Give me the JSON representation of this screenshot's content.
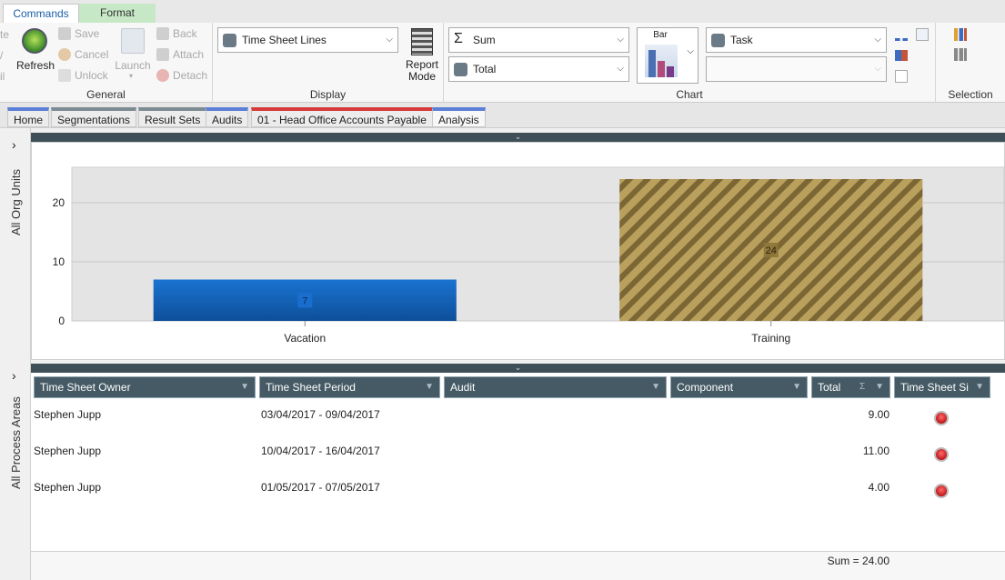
{
  "ribbon": {
    "tabs": [
      "Commands",
      "Format"
    ],
    "general": {
      "label": "General",
      "cut_left": [
        "te",
        "/",
        "il"
      ],
      "refresh": "Refresh",
      "save": "Save",
      "cancel": "Cancel",
      "unlock": "Unlock",
      "launch": "Launch",
      "back": "Back",
      "attach": "Attach",
      "detach": "Detach"
    },
    "display": {
      "label": "Display",
      "view_select": "Time Sheet Lines",
      "report_mode": [
        "Report",
        "Mode"
      ]
    },
    "chart": {
      "label": "Chart",
      "aggregate": "Sum",
      "value_field": "Total",
      "chart_type": "Bar",
      "category_field": "Task",
      "secondary_field": ""
    },
    "selection": {
      "label": "Selection"
    }
  },
  "doc_tabs": [
    {
      "label": "Home",
      "color": "#5b7fd6"
    },
    {
      "label": "Segmentations",
      "color": "#7c8a92"
    },
    {
      "label": "Result Sets",
      "color": "#7c8a92"
    },
    {
      "label": "Audits",
      "color": "#5b7fd6"
    },
    {
      "label": "01 - Head Office Accounts Payable",
      "color": "#d63a3a"
    },
    {
      "label": "Analysis",
      "color": "#5b7fd6"
    }
  ],
  "rail": {
    "top_label": "All Org Units",
    "bottom_label": "All Process Areas",
    "expand_glyph": "›"
  },
  "chart_data": {
    "type": "bar",
    "categories": [
      "Vacation",
      "Training"
    ],
    "values": [
      7,
      24
    ],
    "ylim": [
      0,
      26
    ],
    "yticks": [
      0,
      10,
      20
    ],
    "grid": true,
    "colors": [
      "#1565c0",
      "#a08a4c"
    ],
    "xlabel": "",
    "ylabel": "",
    "title": ""
  },
  "grid": {
    "columns": [
      {
        "label": "Time Sheet Owner"
      },
      {
        "label": "Time Sheet Period"
      },
      {
        "label": "Audit"
      },
      {
        "label": "Component"
      },
      {
        "label": "Total"
      },
      {
        "label": "Time Sheet Si"
      }
    ],
    "rows": [
      {
        "owner": "Stephen Jupp",
        "period": "03/04/2017 - 09/04/2017",
        "total": "9.00"
      },
      {
        "owner": "Stephen Jupp",
        "period": "10/04/2017 - 16/04/2017",
        "total": "11.00"
      },
      {
        "owner": "Stephen Jupp",
        "period": "01/05/2017 - 07/05/2017",
        "total": "4.00"
      }
    ],
    "footer_sum": "Sum = 24.00",
    "sigma": "Σ",
    "filter_glyph": "▼",
    "split_glyph": "⌄"
  }
}
